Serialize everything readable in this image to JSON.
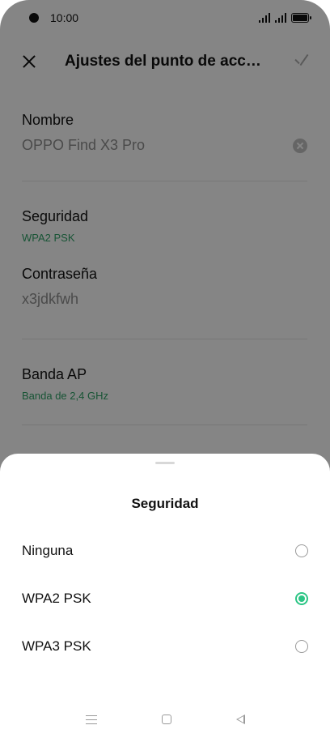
{
  "status_bar": {
    "time": "10:00"
  },
  "appbar": {
    "title": "Ajustes del punto de acceso..."
  },
  "fields": {
    "name_label": "Nombre",
    "name_value": "OPPO Find X3 Pro",
    "security_label": "Seguridad",
    "security_value": "WPA2 PSK",
    "password_label": "Contraseña",
    "password_value": "x3jdkfwh",
    "band_label": "Banda AP",
    "band_value": "Banda de 2,4 GHz"
  },
  "sheet": {
    "title": "Seguridad",
    "options": [
      {
        "label": "Ninguna",
        "selected": false
      },
      {
        "label": "WPA2 PSK",
        "selected": true
      },
      {
        "label": "WPA3 PSK",
        "selected": false
      }
    ]
  },
  "colors": {
    "accent": "#2cc585",
    "sub_text": "#2c9a62"
  }
}
